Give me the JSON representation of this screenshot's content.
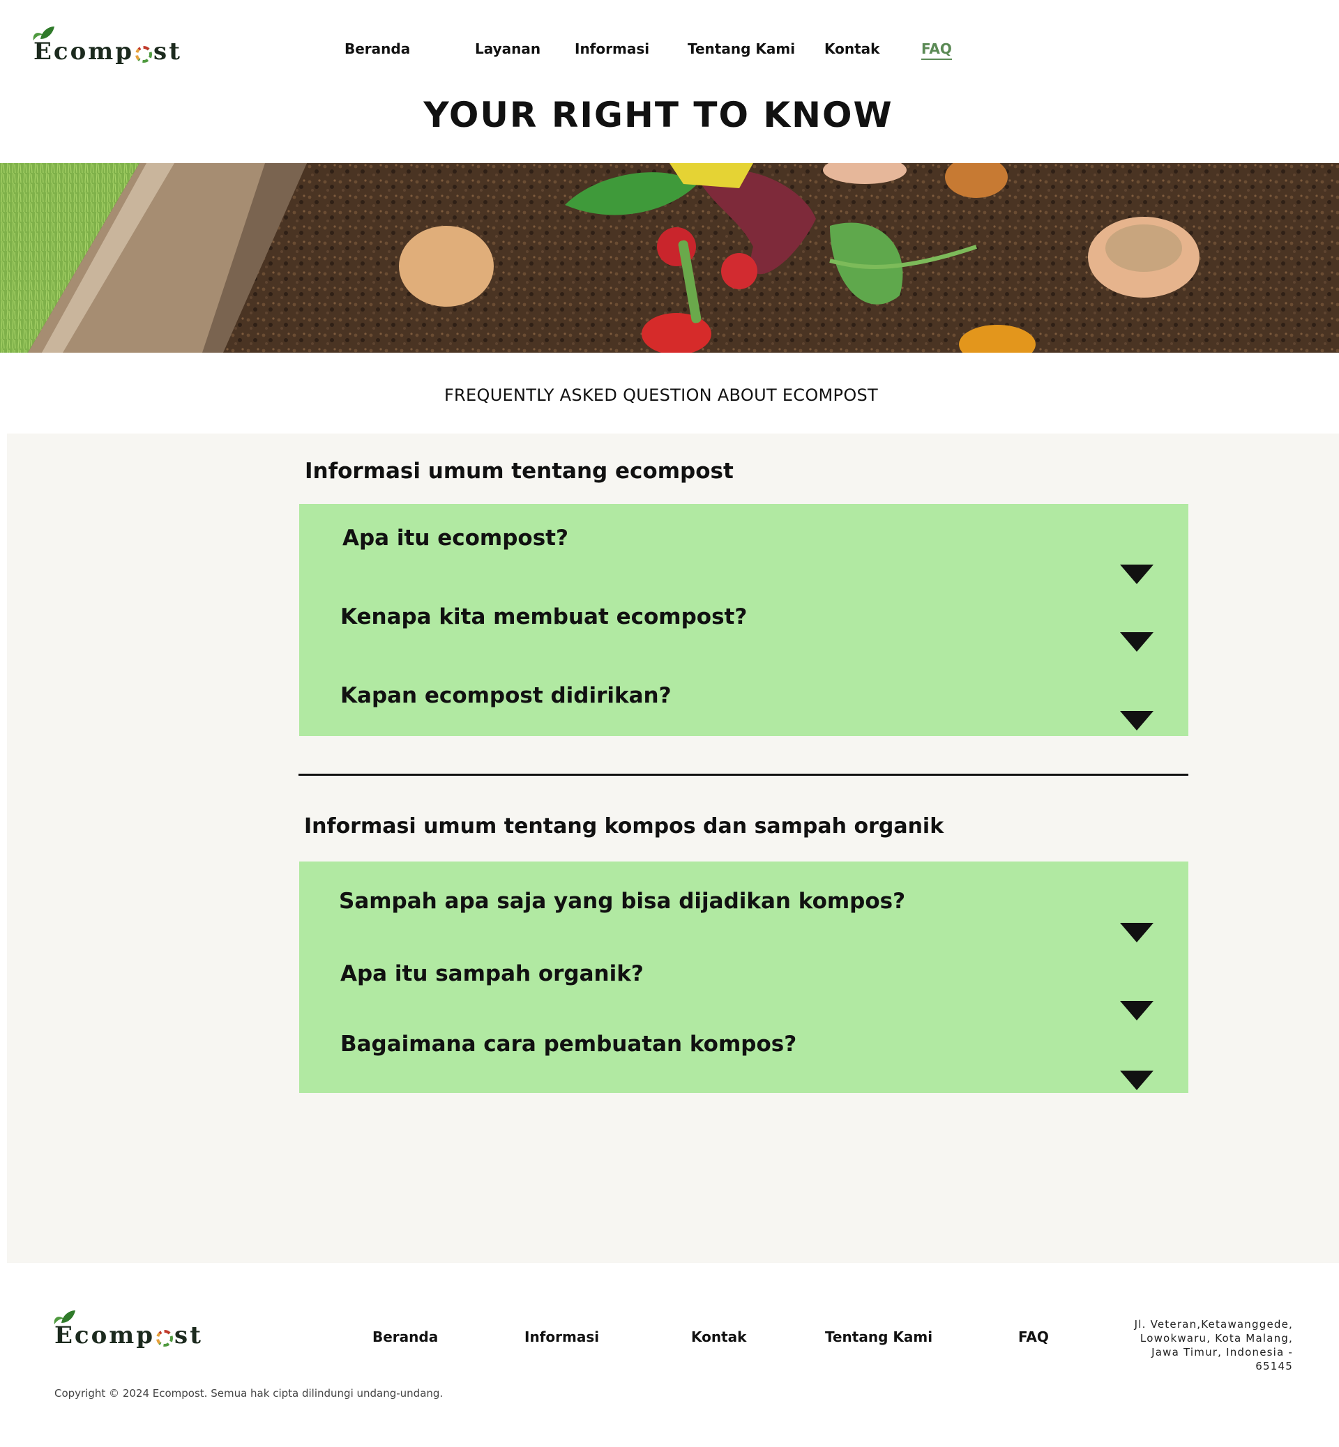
{
  "brand": {
    "name_prefix": "Ecomp",
    "name_suffix": "st",
    "colors": {
      "leaf": "#4f9a3f",
      "accent": "#5b8a55",
      "faq_bg": "#b1e9a2",
      "area_bg": "#f7f6f2"
    }
  },
  "nav": [
    {
      "label": "Beranda"
    },
    {
      "label": "Layanan"
    },
    {
      "label": "Informasi"
    },
    {
      "label": "Tentang Kami"
    },
    {
      "label": "Kontak"
    },
    {
      "label": "FAQ",
      "active": true
    }
  ],
  "hero": {
    "title": "YOUR RIGHT TO KNOW",
    "banner_icon": "compost-photo"
  },
  "subtitle": "FREQUENTLY ASKED QUESTION ABOUT ECOMPOST",
  "sections": [
    {
      "title": "Informasi umum tentang ecompost",
      "items": [
        {
          "question": "Apa itu ecompost?",
          "icon": "triangle-down-icon"
        },
        {
          "question": "Kenapa kita membuat ecompost?",
          "icon": "triangle-down-icon"
        },
        {
          "question": "Kapan ecompost didirikan?",
          "icon": "triangle-down-icon"
        }
      ]
    },
    {
      "title": "Informasi umum tentang kompos dan sampah organik",
      "items": [
        {
          "question": "Sampah apa saja yang bisa dijadikan kompos?",
          "icon": "triangle-down-icon"
        },
        {
          "question": "Apa itu sampah organik?",
          "icon": "triangle-down-icon"
        },
        {
          "question": "Bagaimana cara pembuatan kompos?",
          "icon": "triangle-down-icon"
        }
      ]
    }
  ],
  "footer": {
    "nav": [
      {
        "label": "Beranda"
      },
      {
        "label": "Informasi"
      },
      {
        "label": "Kontak"
      },
      {
        "label": "Tentang Kami"
      },
      {
        "label": "FAQ"
      }
    ],
    "address_lines": [
      "Jl. Veteran,Ketawanggede,",
      "Lowokwaru, Kota Malang,",
      "Jawa Timur, Indonesia -",
      "65145"
    ],
    "copyright": "Copyright © 2024 Ecompost. Semua hak cipta dilindungi undang-undang."
  }
}
